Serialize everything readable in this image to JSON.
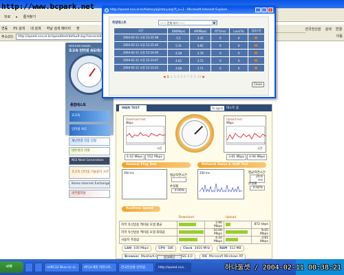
{
  "watermark": "http://www.bcpark.net",
  "signature": "하나둘셋 / 2004-02-11 00:38:21",
  "browser": {
    "toolbar": {
      "back_label": "뒤로",
      "favorites_label": "즐겨찾기"
    },
    "links_left": [
      "연동",
      "PS 검색",
      "네 검색",
      "하날 검색 페이지",
      "편"
    ],
    "links_right": [
      "한국전산원",
      "검색",
      "연결"
    ],
    "address_label": "주소(D)",
    "address_value": "http://speed.nca.or.kr/speedtest/default.asp?serviceid=",
    "go_label": "이동"
  },
  "site": {
    "logo_en": "WEB BENCHMARK",
    "logo_ko": "초고속 인터넷 속도테스트",
    "sidebar_heading": "종합테스트",
    "banners": [
      "초고속",
      "인터넷 속도",
      "재난연결 인증 신청",
      "네트워크 이해",
      "NGI Next Generation",
      "초고속 인터넷 기술용어 사전",
      "Korea Internet Exchange",
      "국무총리실"
    ]
  },
  "test_panel": {
    "tab_wan": "WAN TEST",
    "tab_again": "To again",
    "tab_rest": "테스트 용",
    "download": {
      "title": "Download test",
      "unit": "Mbps",
      "min": "4.42 Mbps",
      "max": "552 Mbps",
      "time": "시간"
    },
    "upload": {
      "title": "Upload test",
      "unit": "Mbps",
      "min": "3.81 Mbps",
      "max": "4.96 Mbps",
      "time": "시간"
    },
    "general_ping": "General Ping Test",
    "network_ping": "Network Game & VoIP Test",
    "ping1": {
      "axis": "300 ms",
      "avg_label": "평균지연시간",
      "avg": "",
      "loss_label": "손실율",
      "loss": "0.00%"
    },
    "ping2": {
      "axis": "200 ms",
      "avg_label": "평균지연시간",
      "avg": "20.6 ms",
      "loss_label": "손실율",
      "loss": "0.00%"
    },
    "realtime": "Realtime Speed Test",
    "results": {
      "header_down": "Download",
      "header_up": "Upload",
      "rows": [
        {
          "label": "지역 유선방송 케이블 모뎀 평균",
          "down": "3.90 Mbps",
          "up": "872 kbps",
          "down_level": 0.7,
          "up_level": 0.2
        },
        {
          "label": "지역 유선방송 케이블 모뎀 최대값",
          "down": "10.00 Mbps",
          "up": "9.05 Mbps",
          "down_level": 1.0,
          "up_level": 0.9
        },
        {
          "label": "사용자 측정값",
          "down": "4.42 Mbps",
          "up": "3.81 Mbps",
          "down_level": 0.75,
          "up_level": 0.5
        }
      ]
    },
    "info": {
      "lan_label": "LAN",
      "lan": "100 Mbps",
      "cpu_label": "CPU",
      "cpu": "586",
      "clock_label": "Clock",
      "clock": "3410 MHz",
      "ram_label": "RAM",
      "ram": "512 MB",
      "browser_label": "Browser",
      "browser_value": "Mozilla/4.0 (compatible; MSIE 6.0",
      "os_label": "OS",
      "os": "Microsoft Windows XP"
    },
    "close_label": "결과확인"
  },
  "popup": {
    "title": "http://speed.nca.or.kr/history/pjistory.asp?f_s=1 - Microsoft Internet Explore",
    "heading": "측정테스트",
    "filter_value": "------ 전체 보기 ------",
    "columns": [
      "시간",
      "DN(Mbps)",
      "UP(Mbps)",
      "RTT(ms)",
      "Loss(%)",
      "검사(기)"
    ],
    "rows": [
      {
        "time": "2004-02-11 오전 12:35:38",
        "dn": "5.5",
        "up": "3.35",
        "rtt": "0",
        "loss": "0"
      },
      {
        "time": "2004-02-11 오전 12:35:40",
        "dn": "5.31",
        "up": "3.65",
        "rtt": "0",
        "loss": "0"
      },
      {
        "time": "2004-02-11 오전 12:34:49",
        "dn": "4.38",
        "up": "3.79",
        "rtt": "0",
        "loss": "0"
      },
      {
        "time": "2004-02-11 오전 12:33:07",
        "dn": "4.62",
        "up": "3.72",
        "rtt": "0",
        "loss": "0"
      },
      {
        "time": "2004-02-11 오전 12:33:33",
        "dn": "4.08",
        "up": "3.71",
        "rtt": "0",
        "loss": "0"
      }
    ],
    "pages": [
      "1",
      "2",
      "3",
      "4",
      "5",
      "6",
      "7",
      "8",
      "9",
      "10"
    ],
    "current_page": "1",
    "close_label": "Close"
  },
  "taskbar": {
    "start_label": "시작",
    "items": [
      "",
      "",
      "mIRC32 Blue-irc s/...",
      "바다소개된 커뮤니티..",
      "한국전산원-인터넷..",
      "http://speed.nca.."
    ]
  }
}
